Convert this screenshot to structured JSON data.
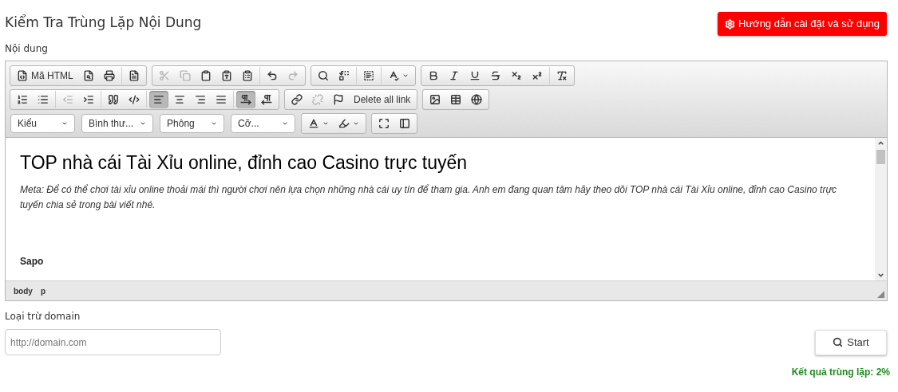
{
  "page_title": "Kiểm Tra Trùng Lặp Nội Dung",
  "guide_button": {
    "label": "Hướng dẫn cài đặt và sử dụng"
  },
  "content_label": "Nội dung",
  "toolbar": {
    "rows": [
      [
        [
          [
            {
              "kind": "icon-text",
              "label": "Mã HTML",
              "disabled": false,
              "pressed": false
            },
            {
              "kind": "icon",
              "disabled": false,
              "pressed": false
            },
            {
              "kind": "icon",
              "disabled": false,
              "pressed": false
            }
          ],
          [
            {
              "kind": "icon",
              "disabled": false,
              "pressed": false
            }
          ]
        ],
        [
          [
            {
              "kind": "icon",
              "disabled": true,
              "pressed": false
            },
            {
              "kind": "icon",
              "disabled": true,
              "pressed": false
            },
            {
              "kind": "icon",
              "disabled": false,
              "pressed": false
            },
            {
              "kind": "icon",
              "disabled": false,
              "pressed": false
            },
            {
              "kind": "icon",
              "disabled": false,
              "pressed": false
            }
          ],
          [
            {
              "kind": "icon",
              "disabled": false,
              "pressed": false
            },
            {
              "kind": "icon",
              "disabled": true,
              "pressed": false
            }
          ]
        ],
        [
          [
            {
              "kind": "icon",
              "disabled": false,
              "pressed": false
            },
            {
              "kind": "icon",
              "disabled": false,
              "pressed": false
            }
          ],
          [
            {
              "kind": "icon",
              "disabled": false,
              "pressed": false
            }
          ],
          [
            {
              "kind": "icon-menu",
              "disabled": false,
              "pressed": false
            }
          ]
        ],
        [
          [
            {
              "kind": "icon",
              "disabled": false,
              "pressed": false
            },
            {
              "kind": "icon",
              "disabled": false,
              "pressed": false
            },
            {
              "kind": "icon",
              "disabled": false,
              "pressed": false
            },
            {
              "kind": "icon",
              "disabled": false,
              "pressed": false
            },
            {
              "kind": "icon",
              "disabled": false,
              "pressed": false
            },
            {
              "kind": "icon",
              "disabled": false,
              "pressed": false
            }
          ],
          [
            {
              "kind": "icon",
              "disabled": false,
              "pressed": false
            }
          ]
        ]
      ],
      [
        [
          [
            {
              "kind": "icon",
              "disabled": false,
              "pressed": false
            },
            {
              "kind": "icon",
              "disabled": false,
              "pressed": false
            }
          ],
          [
            {
              "kind": "icon",
              "disabled": true,
              "pressed": false
            },
            {
              "kind": "icon",
              "disabled": false,
              "pressed": false
            }
          ],
          [
            {
              "kind": "icon",
              "disabled": false,
              "pressed": false
            },
            {
              "kind": "icon",
              "disabled": false,
              "pressed": false
            }
          ],
          [
            {
              "kind": "icon",
              "disabled": false,
              "pressed": true
            },
            {
              "kind": "icon",
              "disabled": false,
              "pressed": false
            },
            {
              "kind": "icon",
              "disabled": false,
              "pressed": false
            },
            {
              "kind": "icon",
              "disabled": false,
              "pressed": false
            }
          ],
          [
            {
              "kind": "icon",
              "disabled": false,
              "pressed": true
            },
            {
              "kind": "icon",
              "disabled": false,
              "pressed": false
            }
          ]
        ],
        [
          [
            {
              "kind": "icon",
              "disabled": false,
              "pressed": false
            },
            {
              "kind": "icon",
              "disabled": true,
              "pressed": false
            },
            {
              "kind": "icon",
              "disabled": false,
              "pressed": false
            },
            {
              "kind": "text",
              "label": "Delete all link",
              "disabled": false,
              "pressed": false
            }
          ]
        ],
        [
          [
            {
              "kind": "icon",
              "disabled": false,
              "pressed": false
            },
            {
              "kind": "icon",
              "disabled": false,
              "pressed": false
            },
            {
              "kind": "icon",
              "disabled": false,
              "pressed": false
            }
          ]
        ]
      ],
      [
        [
          [
            {
              "kind": "dropdown",
              "label": "Kiểu",
              "disabled": false,
              "pressed": false
            }
          ]
        ],
        [
          [
            {
              "kind": "dropdown",
              "label": "Bình thư...",
              "disabled": false,
              "pressed": false
            }
          ]
        ],
        [
          [
            {
              "kind": "dropdown",
              "label": "Phông",
              "disabled": false,
              "pressed": false
            }
          ]
        ],
        [
          [
            {
              "kind": "dropdown",
              "label": "Cỡ...",
              "disabled": false,
              "pressed": false
            }
          ]
        ],
        [
          [
            {
              "kind": "icon-menu",
              "disabled": false,
              "pressed": false
            },
            {
              "kind": "icon-menu",
              "disabled": false,
              "pressed": false
            }
          ]
        ],
        [
          [
            {
              "kind": "icon",
              "disabled": false,
              "pressed": false
            },
            {
              "kind": "icon",
              "disabled": false,
              "pressed": false
            }
          ]
        ]
      ]
    ]
  },
  "document": {
    "heading": "TOP nhà cái Tài Xỉu online, đỉnh cao Casino trực tuyến",
    "meta": "Meta: Để có thể chơi tài xỉu online thoải mái thì người chơi nên lựa chọn những nhà cái uy tín để tham gia. Anh em đang quan tâm hãy theo dõi TOP nhà cái Tài Xỉu online, đỉnh cao Casino trực tuyến chia sẻ trong bài viết nhé.",
    "section": "Sapo"
  },
  "element_path": [
    "body",
    "p"
  ],
  "exclude_label": "Loại trừ domain",
  "domain_field": {
    "placeholder": "http://domain.com"
  },
  "start_button": {
    "label": "Start"
  },
  "result": "Kết quả trùng lặp: 2%"
}
